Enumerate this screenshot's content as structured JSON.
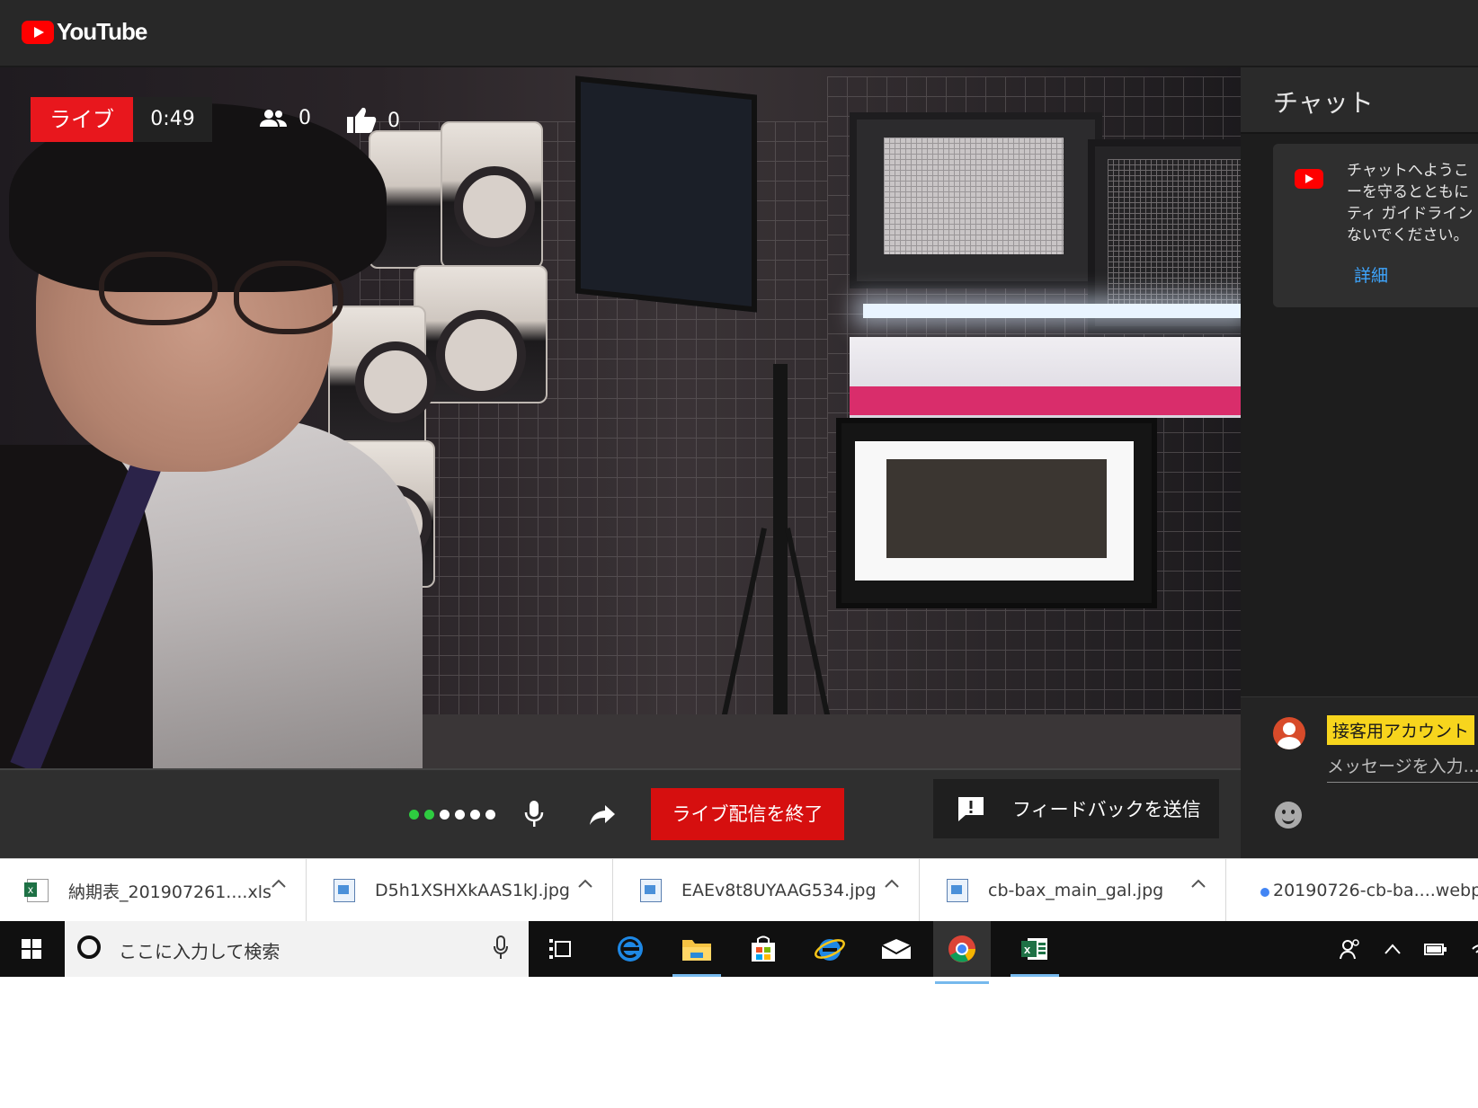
{
  "header": {
    "logo_text": "YouTube"
  },
  "stream": {
    "live_label": "ライブ",
    "elapsed": "0:49",
    "viewers": "0",
    "likes": "0"
  },
  "controls": {
    "end_stream_label": "ライブ配信を終了",
    "feedback_label": "フィードバックを送信"
  },
  "chat": {
    "title": "チャット",
    "welcome_text": "チャットへようこ\nーを守るとともに\nティ ガイドライン\nないでください。",
    "welcome_link": "詳細",
    "username": "接客用アカウント",
    "input_placeholder": "メッセージを入力..."
  },
  "downloads": [
    {
      "name": "納期表_201907261....xls",
      "type": "xls"
    },
    {
      "name": "D5h1XSHXkAAS1kJ.jpg",
      "type": "img"
    },
    {
      "name": "EAEv8t8UYAAG534.jpg",
      "type": "img"
    },
    {
      "name": "cb-bax_main_gal.jpg",
      "type": "img"
    },
    {
      "name": "20190726-cb-ba....webp",
      "type": "webp"
    }
  ],
  "taskbar": {
    "search_placeholder": "ここに入力して検索",
    "apps": [
      "task-view",
      "edge",
      "file-explorer",
      "store",
      "internet-explorer",
      "mail",
      "chrome",
      "excel"
    ]
  },
  "colors": {
    "accent_red": "#e8171d",
    "link_blue": "#3ea6ff",
    "username_highlight": "#f7d51d"
  }
}
